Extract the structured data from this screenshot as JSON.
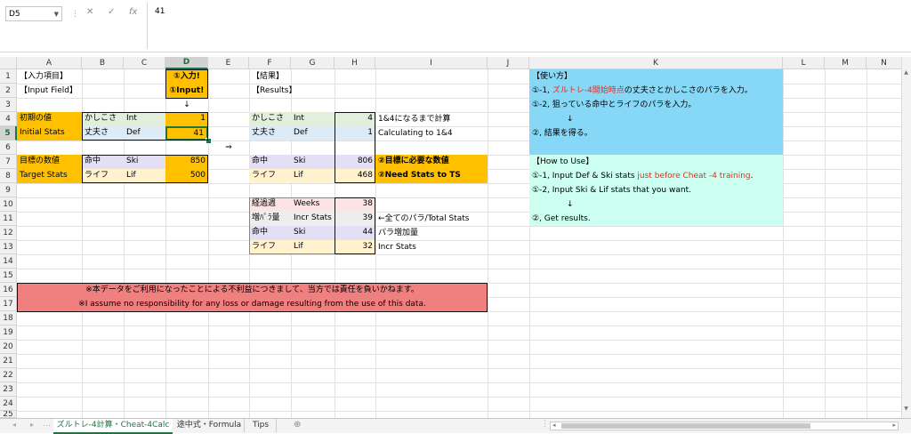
{
  "formula_bar": {
    "name_box": "D5",
    "cancel_icon": "✕",
    "enter_icon": "✓",
    "fx_label": "fx",
    "value": "41"
  },
  "columns": [
    "A",
    "B",
    "C",
    "D",
    "E",
    "F",
    "G",
    "H",
    "I",
    "J",
    "K",
    "L",
    "M",
    "N"
  ],
  "rows": [
    "1",
    "2",
    "3",
    "4",
    "5",
    "6",
    "7",
    "8",
    "9",
    "10",
    "11",
    "12",
    "13",
    "14",
    "15",
    "16",
    "17",
    "18",
    "19",
    "20",
    "21",
    "22",
    "23",
    "24",
    "25"
  ],
  "cells": {
    "A1": "【入力項目】",
    "A2": "【Input Field】",
    "D1": "①入力!",
    "D2": "①Input!",
    "D3": "↓",
    "A4": "初期の値",
    "A5": "Initial Stats",
    "B4": "かしこさ",
    "C4": "Int",
    "D4": "1",
    "B5": "丈夫さ",
    "C5": "Def",
    "D5": "41",
    "E6": "⇒",
    "A7": "目標の数値",
    "A8": "Target Stats",
    "B7": "命中",
    "C7": "Ski",
    "D7": "850",
    "B8": "ライフ",
    "C8": "Lif",
    "D8": "500",
    "F1": "【結果】",
    "F2": "【Results】",
    "F4": "かしこさ",
    "G4": "Int",
    "H4": "4",
    "I4": "1&4になるまで計算",
    "F5": "丈夫さ",
    "G5": "Def",
    "H5": "1",
    "I5": "Calculating to 1&4",
    "F7": "命中",
    "G7": "Ski",
    "H7": "806",
    "I7": "②目標に必要な数値",
    "F8": "ライフ",
    "G8": "Lif",
    "H8": "468",
    "I8": "②Need Stats to TS",
    "F10": "経過週",
    "G10": "Weeks",
    "H10": "38",
    "F11": "増ﾊﾟﾗ量",
    "G11": "Incr Stats",
    "H11": "39",
    "I11": "←全てのパラ/Total Stats",
    "F12": "命中",
    "G12": "Ski",
    "H12": "44",
    "I12": "パラ増加量",
    "F13": "ライフ",
    "G13": "Lif",
    "H13": "32",
    "I13": "Incr Stats",
    "A16": "※本データをご利用になったことによる不利益につきまして、当方では責任を負いかねます。",
    "A17": "※I assume no responsibility for any loss or damage resulting from the use of this data.",
    "K1": "【使い方】",
    "K2a": "①-1, ",
    "K2b": "ズルトレ-4開始時点",
    "K2c": "の丈夫さとかしこさのパラを入力。",
    "K3": "①-2, 狙っている命中とライフのパラを入力。",
    "K4": "↓",
    "K5": "②, 結果を得る。",
    "K7": "【How to Use】",
    "K8a": "①-1, Input Def & Ski stats ",
    "K8b": "just before Cheat -4 training",
    "K8c": ".",
    "K9": "①-2, Input Ski & Lif stats that you want.",
    "K10": "↓",
    "K11": "②, Get results."
  },
  "sheet_tabs": [
    "ズルトレ-4計算・Cheat-4Calc",
    "途中式・Formula",
    "Tips"
  ],
  "add_sheet_icon": "⊕",
  "colors": {
    "orange": "#ffc000",
    "green": "#e2efda",
    "blue": "#ddebf7",
    "purple": "#e4dff5",
    "cream": "#fff2cc",
    "pink": "#fce4e4",
    "grey": "#ededed",
    "red_box": "#f08080",
    "sky": "#87d7f7",
    "mint": "#ccfff0",
    "red_text": "#e0301e",
    "excel_green": "#217346"
  }
}
